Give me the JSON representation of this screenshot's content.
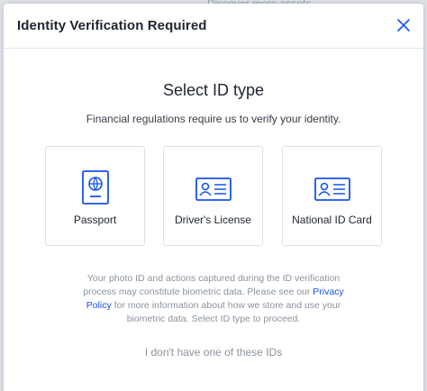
{
  "background": {
    "hint_text": "Discover more assets"
  },
  "modal": {
    "title": "Identity Verification Required",
    "heading": "Select ID type",
    "subheading": "Financial regulations require us to verify your identity.",
    "options": [
      {
        "label": "Passport",
        "icon": "passport-icon"
      },
      {
        "label": "Driver's License",
        "icon": "id-card-icon"
      },
      {
        "label": "National ID Card",
        "icon": "id-card-icon"
      }
    ],
    "notice": {
      "before_link": "Your photo ID and actions captured during the ID verification process may constitute biometric data. Please see our ",
      "link": "Privacy Policy",
      "after_link": " for more information about how we store and use your biometric data. Select ID type to proceed."
    },
    "no_id_link": "I don't have one of these IDs"
  },
  "colors": {
    "accent": "#1652f0",
    "text": "#1e2530",
    "muted": "#8a939e",
    "border": "#dde1e6"
  }
}
